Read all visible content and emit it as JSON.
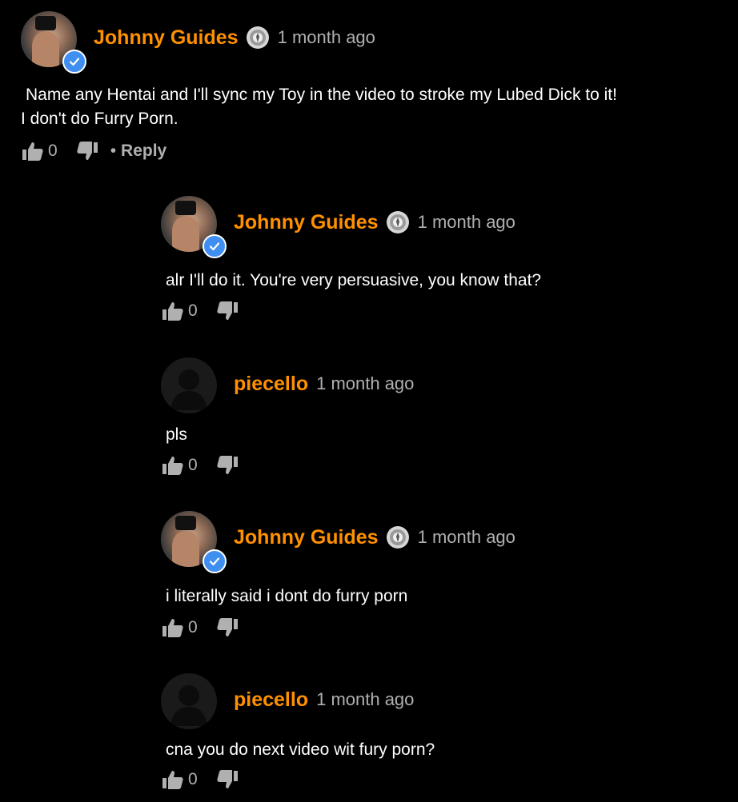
{
  "comments": [
    {
      "username": "Johnny Guides",
      "time": "1 month ago",
      "lines": [
        "Name any Hentai and I'll sync my Toy in the video to stroke my Lubed Dick to it!",
        "I don't do Furry Porn."
      ],
      "likes": "0",
      "reply_dot": "•",
      "reply_label": "Reply",
      "avatar": "photo",
      "verified": true
    },
    {
      "username": "Johnny Guides",
      "time": "1 month ago",
      "lines": [
        "alr I'll do it. You're very persuasive, you know that?"
      ],
      "likes": "0",
      "avatar": "photo",
      "verified": true
    },
    {
      "username": "piecello",
      "time": "1 month ago",
      "lines": [
        "pls"
      ],
      "likes": "0",
      "avatar": "default",
      "verified": false
    },
    {
      "username": "Johnny Guides",
      "time": "1 month ago",
      "lines": [
        "i literally said i dont do furry porn"
      ],
      "likes": "0",
      "avatar": "photo",
      "verified": true
    },
    {
      "username": "piecello",
      "time": "1 month ago",
      "lines": [
        "cna you do next video wit fury porn?"
      ],
      "likes": "0",
      "avatar": "default",
      "verified": false
    }
  ],
  "colors": {
    "background": "#000000",
    "username": "#ff9000",
    "muted": "#b0b0b0",
    "verified": "#3f8ff0"
  },
  "icons": {
    "like": "thumbs-up-icon",
    "dislike": "thumbs-down-icon",
    "verified": "checkmark-badge-icon",
    "rank": "rank-badge-icon"
  }
}
